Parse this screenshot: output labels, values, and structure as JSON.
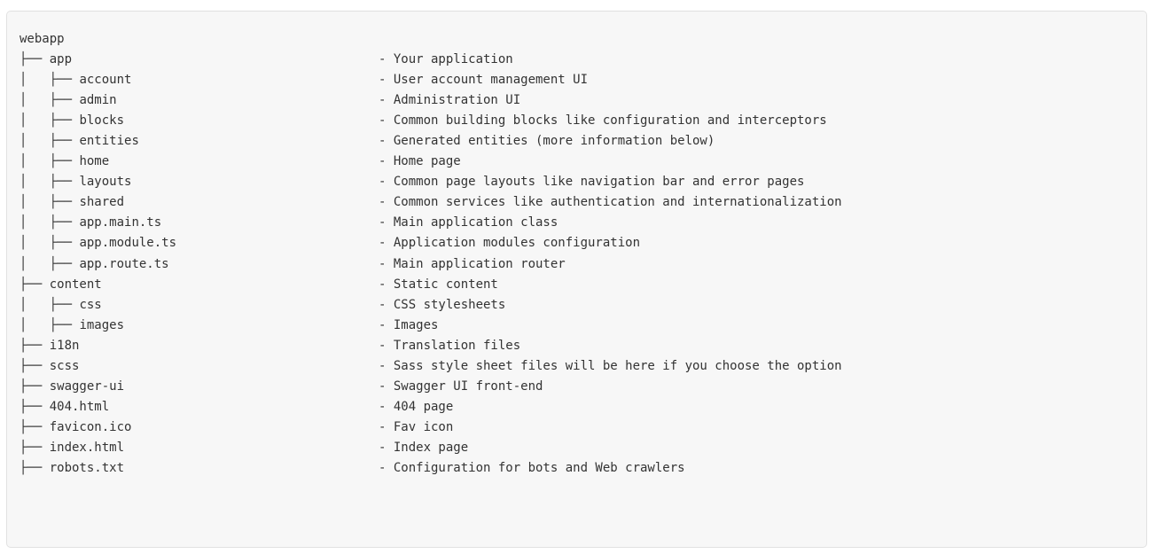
{
  "tree": {
    "root": "webapp",
    "entries": [
      {
        "prefix": "├── ",
        "name": "app",
        "desc": "- Your application"
      },
      {
        "prefix": "│   ├── ",
        "name": "account",
        "desc": "- User account management UI"
      },
      {
        "prefix": "│   ├── ",
        "name": "admin",
        "desc": "- Administration UI"
      },
      {
        "prefix": "│   ├── ",
        "name": "blocks",
        "desc": "- Common building blocks like configuration and interceptors"
      },
      {
        "prefix": "│   ├── ",
        "name": "entities",
        "desc": "- Generated entities (more information below)"
      },
      {
        "prefix": "│   ├── ",
        "name": "home",
        "desc": "- Home page"
      },
      {
        "prefix": "│   ├── ",
        "name": "layouts",
        "desc": "- Common page layouts like navigation bar and error pages"
      },
      {
        "prefix": "│   ├── ",
        "name": "shared",
        "desc": "- Common services like authentication and internationalization"
      },
      {
        "prefix": "│   ├── ",
        "name": "app.main.ts",
        "desc": "- Main application class"
      },
      {
        "prefix": "│   ├── ",
        "name": "app.module.ts",
        "desc": "- Application modules configuration"
      },
      {
        "prefix": "│   ├── ",
        "name": "app.route.ts",
        "desc": "- Main application router"
      },
      {
        "prefix": "├── ",
        "name": "content",
        "desc": "- Static content"
      },
      {
        "prefix": "│   ├── ",
        "name": "css",
        "desc": "- CSS stylesheets"
      },
      {
        "prefix": "│   ├── ",
        "name": "images",
        "desc": "- Images"
      },
      {
        "prefix": "├── ",
        "name": "i18n",
        "desc": "- Translation files"
      },
      {
        "prefix": "├── ",
        "name": "scss",
        "desc": "- Sass style sheet files will be here if you choose the option"
      },
      {
        "prefix": "├── ",
        "name": "swagger-ui",
        "desc": "- Swagger UI front-end"
      },
      {
        "prefix": "├── ",
        "name": "404.html",
        "desc": "- 404 page"
      },
      {
        "prefix": "├── ",
        "name": "favicon.ico",
        "desc": "- Fav icon"
      },
      {
        "prefix": "├── ",
        "name": "index.html",
        "desc": "- Index page"
      },
      {
        "prefix": "├── ",
        "name": "robots.txt",
        "desc": "- Configuration for bots and Web crawlers"
      }
    ]
  }
}
